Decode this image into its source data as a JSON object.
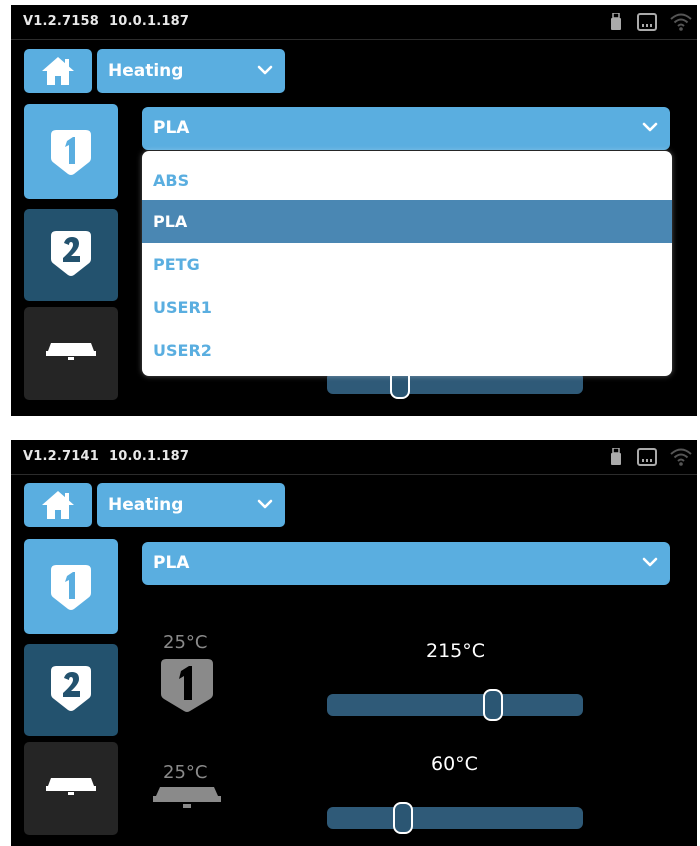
{
  "screens": [
    {
      "status": {
        "version": "V1.2.7158",
        "ip": "10.0.1.187"
      },
      "mode_select": {
        "label": "Heating"
      },
      "material_select": {
        "value": "PLA",
        "options": [
          "ABS",
          "PLA",
          "PETG",
          "USER1",
          "USER2"
        ],
        "selected_index": 1,
        "open": true
      },
      "tabs": [
        "1",
        "2",
        "bed"
      ],
      "active_tab": 0
    },
    {
      "status": {
        "version": "V1.2.7141",
        "ip": "10.0.1.187"
      },
      "mode_select": {
        "label": "Heating"
      },
      "material_select": {
        "value": "PLA",
        "open": false
      },
      "tabs": [
        "1",
        "2",
        "bed"
      ],
      "active_tab": 0,
      "nozzle": {
        "current_temp": "25°C",
        "target_temp": "215°C",
        "target_level": 0.66
      },
      "bed": {
        "current_temp": "25°C",
        "target_temp": "60°C",
        "target_level": 0.28
      }
    }
  ],
  "colors": {
    "accent": "#5aaee0",
    "tab_dark": "#23526e",
    "selected": "#4a87b3",
    "track": "#2f5a78"
  },
  "icons": [
    "usb-icon",
    "ethernet-icon",
    "wifi-icon",
    "home-icon",
    "chevron-down-icon",
    "extruder-1-icon",
    "extruder-2-icon",
    "bed-icon"
  ]
}
